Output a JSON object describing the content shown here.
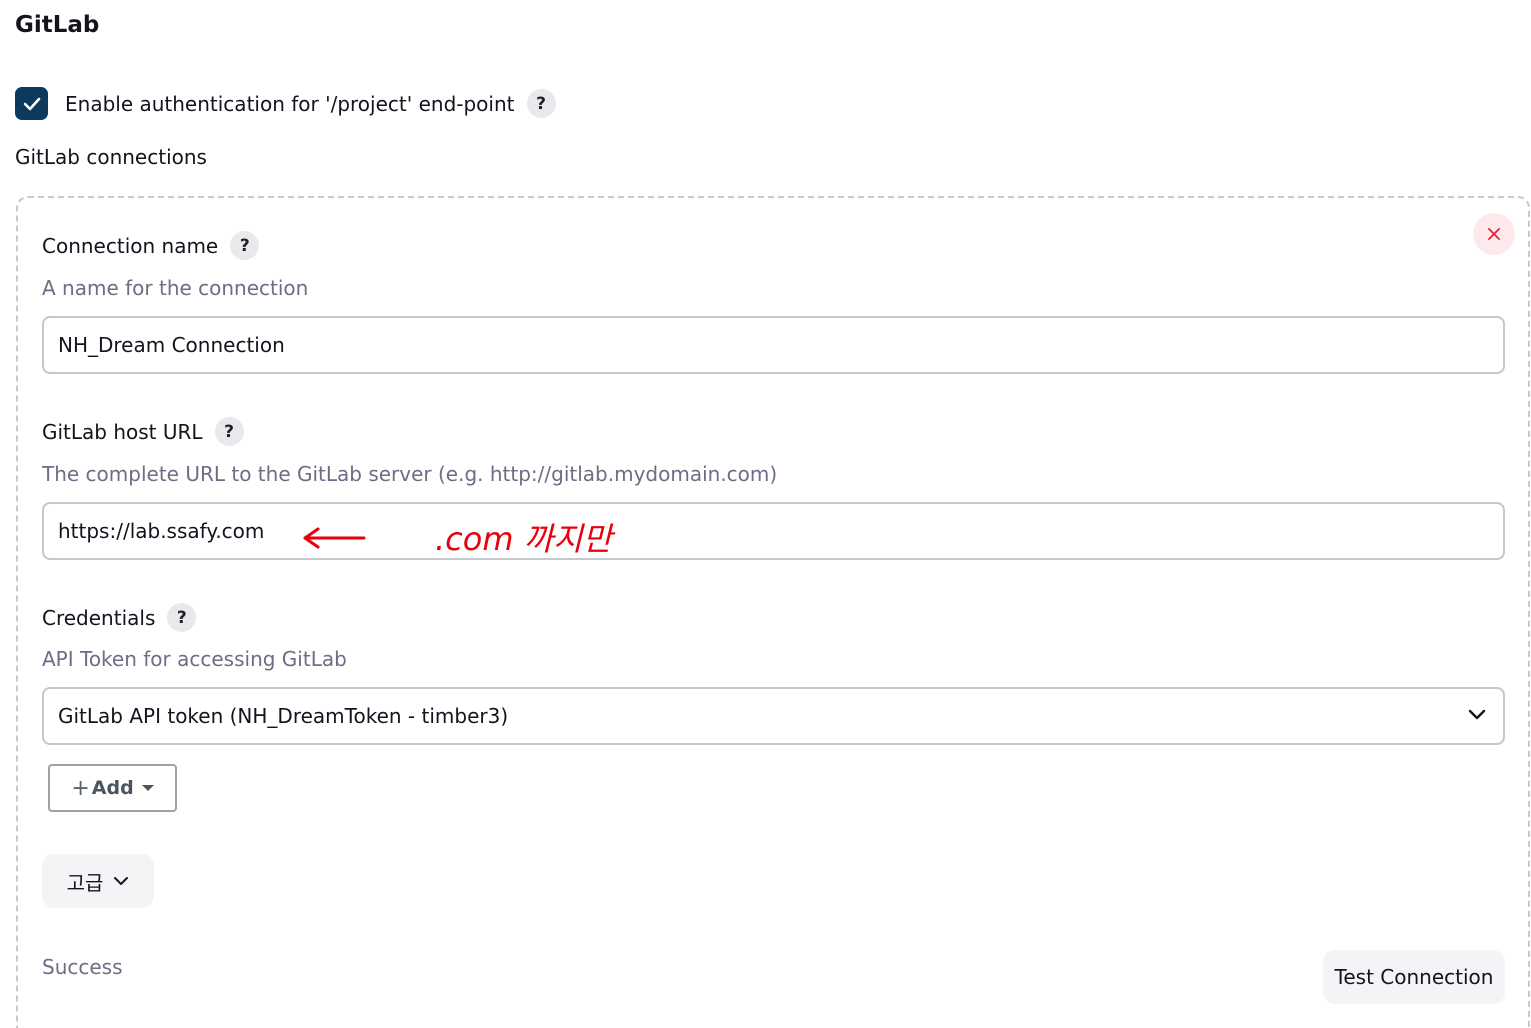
{
  "section": {
    "title": "GitLab"
  },
  "auth": {
    "checked": true,
    "label": "Enable authentication for '/project' end-point",
    "help": "?"
  },
  "connections": {
    "label": "GitLab connections",
    "delete_icon": "close-icon",
    "connection_name": {
      "label": "Connection name",
      "help": "?",
      "description": "A name for the connection",
      "value": "NH_Dream Connection"
    },
    "host_url": {
      "label": "GitLab host URL",
      "help": "?",
      "description": "The complete URL to the GitLab server (e.g. http://gitlab.mydomain.com)",
      "value": "https://lab.ssafy.com"
    },
    "credentials": {
      "label": "Credentials",
      "help": "?",
      "description": "API Token for accessing GitLab",
      "selected": "GitLab API token (NH_DreamToken - timber3)"
    },
    "add_button": {
      "plus": "+",
      "label": "Add"
    },
    "advanced_button": {
      "label": "고급"
    },
    "status": "Success",
    "test_button": {
      "label": "Test Connection"
    }
  },
  "annotation": {
    "text": ".com 까지만",
    "color": "#e8000b"
  },
  "colors": {
    "checkbox": "#0d3a5c",
    "description_text": "#6b6e85",
    "delete_bg": "#fde9ec",
    "delete_icon": "#e0203a"
  }
}
